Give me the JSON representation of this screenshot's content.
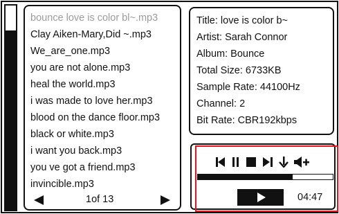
{
  "playlist": {
    "items": [
      "bounce love is color bl~.mp3",
      "Clay Aiken-Mary,Did ~.mp3",
      "We_are_one.mp3",
      "you are not alone.mp3",
      "heal the world.mp3",
      "i was made to love her.mp3",
      "blood on the dance floor.mp3",
      "black or white.mp3",
      "i want you back.mp3",
      "you ve got a friend.mp3",
      "invincible.mp3"
    ],
    "selected_index": 0,
    "page_label": "1of 13",
    "prev_icon": "triangle-left-icon",
    "next_icon": "triangle-right-icon"
  },
  "track_info": {
    "title": "Title: love is color b~",
    "artist": "Artist: Sarah Connor",
    "album": "Album: Bounce",
    "total_size": "Total Size: 6733KB",
    "sample_rate": "Sample Rate: 44100Hz",
    "channel": "Channel: 2",
    "bit_rate": "Bit Rate: CBR192kbps"
  },
  "player": {
    "controls": [
      "skip-back-icon",
      "pause-icon",
      "stop-icon",
      "skip-forward-icon",
      "download-icon",
      "volume-up-icon"
    ],
    "progress": 0.7,
    "play_icon": "play-icon",
    "time": "04:47"
  },
  "colors": {
    "ink": "#111111",
    "selected_text": "#9b9b9b",
    "highlight": "#e8141c"
  }
}
